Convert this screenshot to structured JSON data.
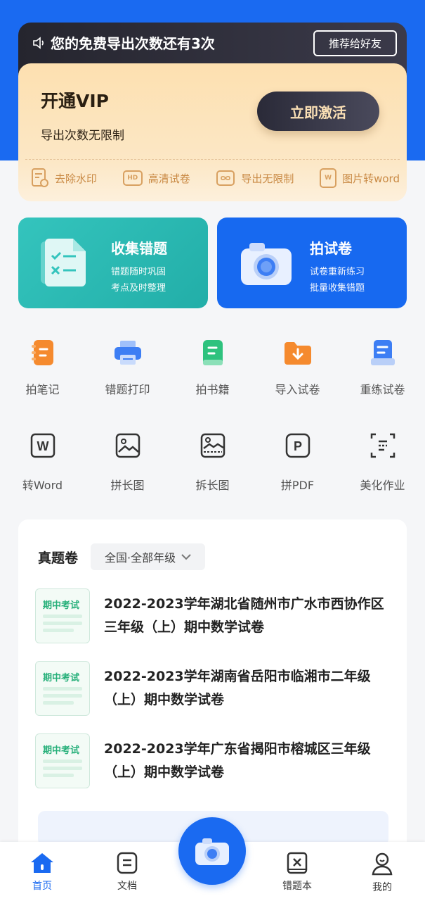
{
  "vip_banner": {
    "notice_text": "您的免费导出次数还有3次",
    "share_button": "推荐给好友",
    "title": "开通VIP",
    "subtitle": "导出次数无限制",
    "activate_button": "立即激活",
    "features": [
      {
        "label": "去除水印",
        "icon": "watermark-remove-icon"
      },
      {
        "label": "高清试卷",
        "icon": "hd-icon",
        "badge": "HD"
      },
      {
        "label": "导出无限制",
        "icon": "infinity-export-icon"
      },
      {
        "label": "图片转word",
        "icon": "word-doc-icon",
        "badge": "W"
      }
    ]
  },
  "feature_cards": [
    {
      "title": "收集错题",
      "line1": "错题随时巩固",
      "line2": "考点及时整理",
      "icon": "mistake-collection-icon"
    },
    {
      "title": "拍试卷",
      "line1": "试卷重新练习",
      "line2": "批量收集错题",
      "icon": "camera-icon"
    }
  ],
  "tools_row1": [
    {
      "label": "拍笔记",
      "icon": "notebook-icon"
    },
    {
      "label": "错题打印",
      "icon": "printer-icon"
    },
    {
      "label": "拍书籍",
      "icon": "book-icon"
    },
    {
      "label": "导入试卷",
      "icon": "import-folder-icon"
    },
    {
      "label": "重练试卷",
      "icon": "retake-paper-icon"
    }
  ],
  "tools_row2": [
    {
      "label": "转Word",
      "icon": "word-convert-icon",
      "glyph": "W"
    },
    {
      "label": "拼长图",
      "icon": "stitch-image-icon"
    },
    {
      "label": "拆长图",
      "icon": "split-image-icon"
    },
    {
      "label": "拼PDF",
      "icon": "pdf-merge-icon",
      "glyph": "P"
    },
    {
      "label": "美化作业",
      "icon": "beautify-homework-icon"
    }
  ],
  "exam_section": {
    "title": "真题卷",
    "filter": "全国·全部年级",
    "thumb_tag": "期中考试",
    "items": [
      {
        "name": "2022-2023学年湖北省随州市广水市西协作区三年级（上）期中数学试卷"
      },
      {
        "name": "2022-2023学年湖南省岳阳市临湘市二年级（上）期中数学试卷"
      },
      {
        "name": "2022-2023学年广东省揭阳市榕城区三年级（上）期中数学试卷"
      }
    ]
  },
  "bottom_nav": [
    {
      "label": "首页",
      "icon": "home-icon",
      "active": true
    },
    {
      "label": "文档",
      "icon": "document-icon"
    },
    {
      "label": "",
      "icon": "camera-fab-icon"
    },
    {
      "label": "错题本",
      "icon": "mistake-book-icon"
    },
    {
      "label": "我的",
      "icon": "profile-icon"
    }
  ],
  "colors": {
    "primary_blue": "#1a6af1",
    "teal": "#2bbab3",
    "vip_gold": "#fce3b8",
    "accent_orange": "#f58a2e",
    "accent_green": "#2ec27e"
  }
}
